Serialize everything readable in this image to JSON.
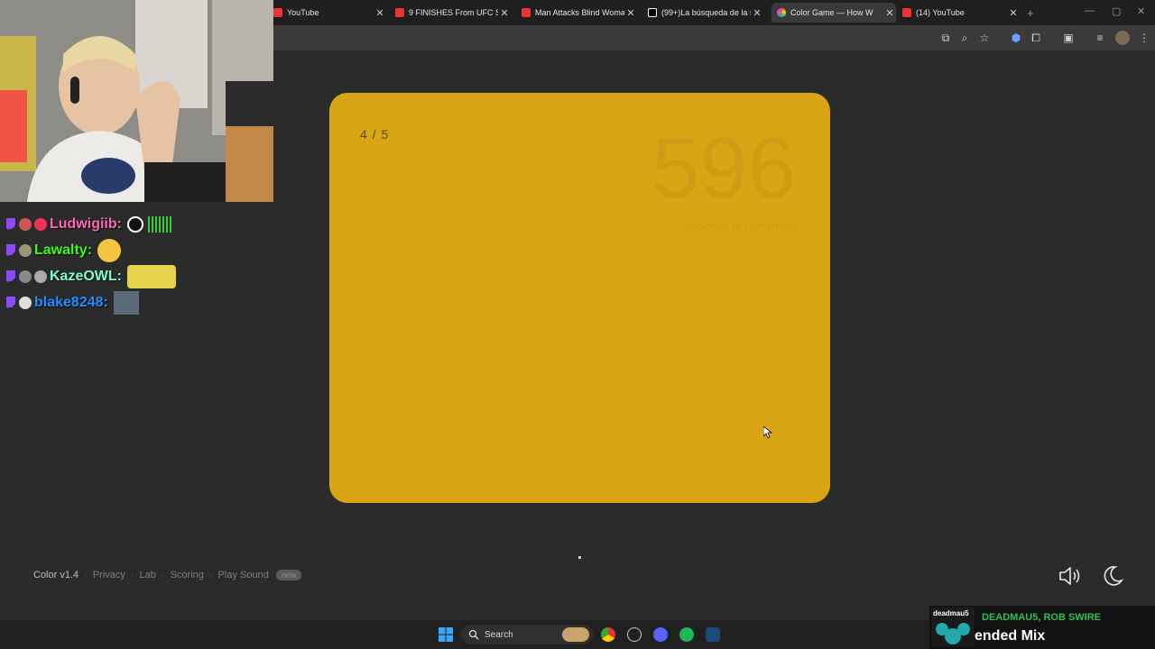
{
  "browser": {
    "tabs": [
      {
        "title": "YouTube",
        "favicon_color": "#e33"
      },
      {
        "title": "9 FINISHES From UFC Sea",
        "favicon_color": "#e33"
      },
      {
        "title": "Man Attacks Blind Woman",
        "favicon_color": "#e33"
      },
      {
        "title": "(99+)La búsqueda de la sa",
        "favicon_color": "#ffffff"
      },
      {
        "title": "Color Game — How W",
        "favicon_color": "#f4a"
      },
      {
        "title": "(14) YouTube",
        "favicon_color": "#e33"
      }
    ],
    "new_tab": "+"
  },
  "game": {
    "level": "4 / 5",
    "timer": "596",
    "timer_label": "Seconds to remember",
    "card_color": "#daa514"
  },
  "footer": {
    "version": "Color v1.4",
    "links": [
      "Privacy",
      "Lab",
      "Scoring",
      "Play Sound"
    ],
    "badge": "new"
  },
  "chat": [
    {
      "user": "Ludwigiib:",
      "color": "#ff69b4"
    },
    {
      "user": "Lawalty:",
      "color": "#39ff14"
    },
    {
      "user": "KazeOWL:",
      "color": "#7fffd4"
    },
    {
      "user": "blake8248:",
      "color": "#1e90ff"
    }
  ],
  "taskbar": {
    "search_label": "Search"
  },
  "now_playing": {
    "logo": "deadmau5",
    "artist": "DEADMAU5, ROB SWIRE",
    "title": "ended Mix"
  },
  "icons": {
    "sound": "speaker-icon",
    "theme": "moon-icon"
  }
}
